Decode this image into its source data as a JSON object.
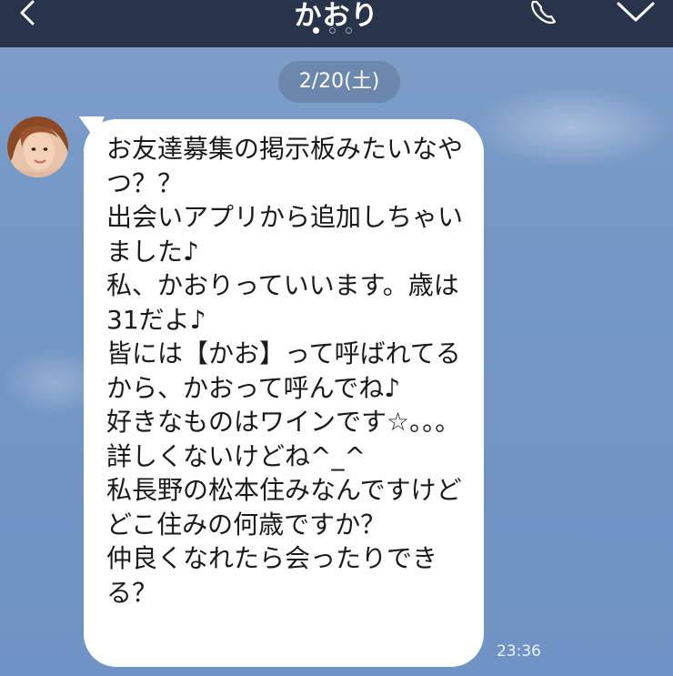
{
  "header": {
    "title": "かおり",
    "page_indicator": {
      "count": 3,
      "active_index": 0
    }
  },
  "icons": {
    "back": "back-arrow-icon",
    "call": "phone-icon",
    "menu": "chevron-down-icon"
  },
  "colors": {
    "header_bg": "#28344a",
    "chat_bg": "#7396c6",
    "bubble_bg": "#ffffff"
  },
  "date_separator": "2/20(土)",
  "messages": [
    {
      "sender": "かおり",
      "text": "お友達募集の掲示板みたいなやつ？？\n出会いアプリから追加しちゃいました♪\n私、かおりっていいます。歳は31だよ♪\n皆には【かお】って呼ばれてるから、かおって呼んでね♪\n好きなものはワインです☆。。。\n詳しくないけどね^_^\n私長野の松本住みなんですけどどこ住みの何歳ですか？\n仲良くなれたら会ったりできる？",
      "time": "23:36"
    }
  ]
}
